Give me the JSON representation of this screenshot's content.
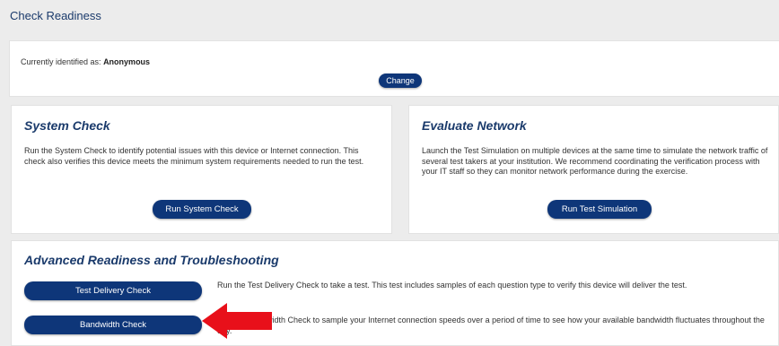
{
  "page": {
    "title": "Check Readiness"
  },
  "identity": {
    "prefix": "Currently identified as:",
    "user": "Anonymous",
    "change_label": "Change"
  },
  "system_check": {
    "title": "System Check",
    "description": "Run the System Check to identify potential issues with this device or Internet connection. This check also verifies this device meets the minimum system requirements needed to run the test.",
    "button_label": "Run System Check"
  },
  "evaluate_network": {
    "title": "Evaluate Network",
    "description": "Launch the Test Simulation on multiple devices at the same time to simulate the network traffic of several test takers at your institution. We recommend coordinating the verification process with your IT staff so they can monitor network performance during the exercise.",
    "button_label": "Run Test Simulation"
  },
  "advanced": {
    "title": "Advanced Readiness and Troubleshooting",
    "items": [
      {
        "button_label": "Test Delivery Check",
        "description": "Run the Test Delivery Check to take a test. This test includes samples of each question type to verify this device will deliver the test."
      },
      {
        "button_label": "Bandwidth Check",
        "description": "Run the Bandwidth Check to sample your Internet connection speeds over a period of time to see how your available bandwidth fluctuates throughout the day."
      }
    ]
  },
  "colors": {
    "primary": "#0e3679",
    "heading": "#1a3a6b",
    "arrow": "#e8101a",
    "background": "#ececec"
  },
  "icons": {
    "annotation": "red-arrow-icon"
  }
}
